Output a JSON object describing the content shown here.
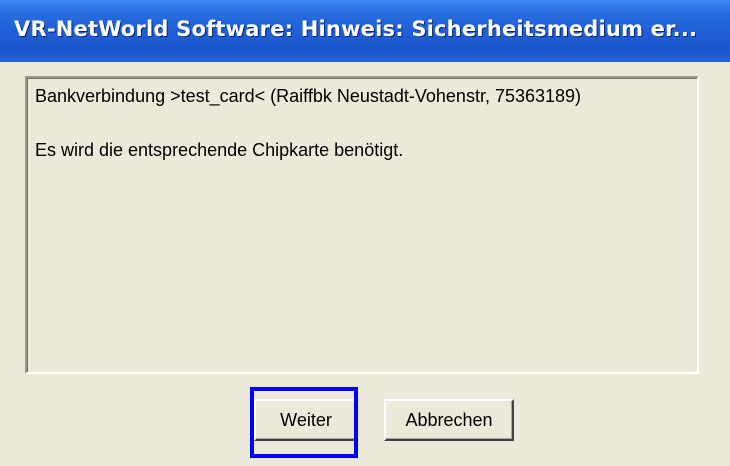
{
  "window": {
    "title": "VR-NetWorld Software: Hinweis: Sicherheitsmedium er..."
  },
  "message": {
    "line1": "Bankverbindung >test_card< (Raiffbk Neustadt-Vohenstr, 75363189)",
    "line2": "Es wird die entsprechende Chipkarte benötigt."
  },
  "buttons": {
    "continue_label": "Weiter",
    "cancel_label": "Abbrechen"
  },
  "colors": {
    "titlebar": "#1f5fd6",
    "dialog_background": "#ece9d8",
    "highlight": "#0000ff"
  }
}
